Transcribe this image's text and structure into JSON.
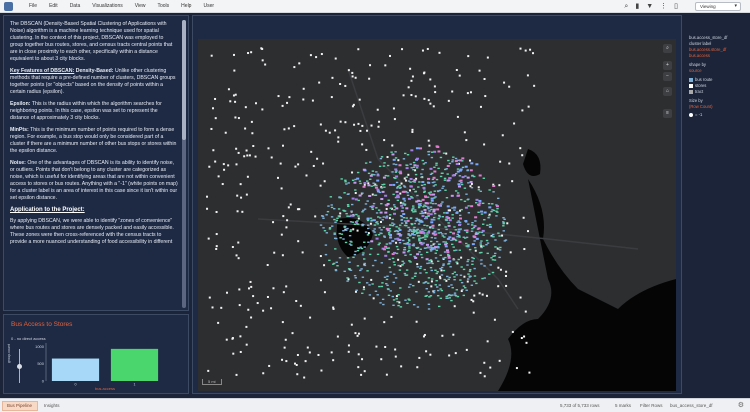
{
  "menu": [
    "File",
    "Edit",
    "Data",
    "Visualizations",
    "View",
    "Tools",
    "Help",
    "User"
  ],
  "toolbar": {
    "icons": [
      "search-icon",
      "bookmark-icon",
      "filter-icon",
      "more-icon",
      "file-icon"
    ],
    "viewing_label": "Viewing"
  },
  "text_panel": {
    "p1": "The DBSCAN (Density-Based Spatial Clustering of Applications with Noise) algorithm is a machine learning technique used for spatial clustering. In the context of this project, DBSCAN was employed to group together bus routes, stores, and census tracts central points that are in close proximity to each other, specifically within a distance equivalent to about 3 city blocks.",
    "kf_head": "Key Features of DBSCAN:",
    "kf_lead": "Density-Based:",
    "kf_body": "Unlike other clustering methods that require a pre-defined number of clusters, DBSCAN groups together points (or \"objects\" based on the density of points within a certain radius (epsilon).",
    "eps_lead": "Epsilon:",
    "eps_body": "This is the radius within which the algorithm searches for neighboring points. In this case, epsilon was set to represent the distance of approximately 3 city blocks.",
    "minpts_lead": "MinPts:",
    "minpts_body": "This is the minimum number of points required to form a dense region. For example, a bus stop would only be considered part of a cluster if there are a minimum number of other bus stops or stores within the epsilon distance.",
    "noise_lead": "Noise:",
    "noise_body": "One of the advantages of DBSCAN is its ability to identify noise, or outliers. Points that don't belong to any cluster are categorized as noise, which is useful for identifying areas that are not within convenient access to stores or bus routes. Anything with a \"-1\" (white points on map) for a cluster label is an area of interest in this case since it isn't within our set epsilon distance.",
    "app_head": "Application to the Project:",
    "app_body": "By applying DBSCAN, we were able to identify \"zones of convenience\" where bus routes and stores are densely packed and easily accessible. These zones were then cross-referenced with the census tracts to provide a more nuanced understanding of food accessibility in different"
  },
  "bus_chart": {
    "title": "Bus Access to Stores",
    "subtitle": "0 - no direct access",
    "slider_label": "group.count",
    "slider_value": 0.5,
    "xlabel": "bus.access"
  },
  "chart_data": {
    "type": "bar",
    "categories": [
      "0",
      "1"
    ],
    "values": [
      650,
      930
    ],
    "xlabel": "bus.access",
    "yticks": [
      "1000",
      "500",
      "0"
    ],
    "ylim": [
      0,
      1100
    ],
    "colors": [
      "#a8d8f8",
      "#4bd66d"
    ]
  },
  "map": {
    "scale_label": "5 mi",
    "buttons": [
      "search-icon",
      "zoom-in-icon",
      "zoom-out-icon",
      "compass-icon",
      "layers-icon"
    ]
  },
  "legend": {
    "color_title": "bus.access_store_df",
    "color_sub": "cluster label",
    "color_link": "bus.access.store_df bus.access",
    "shape_title": "shape by",
    "shape_val": "source",
    "items": [
      {
        "label": "bus route",
        "color": "#7fb0d8"
      },
      {
        "label": "stores",
        "color": "#ffffff"
      },
      {
        "label": "tract",
        "color": "#aaaaaa"
      }
    ],
    "size_title": "Size by",
    "size_val": "(Row Count)",
    "noise_label": "= -1"
  },
  "statusbar": {
    "active_tab": "Bus Pipeline",
    "tab2": "Insights",
    "rows": "5,733 of 5,733 rows",
    "marks": "5 marks",
    "filters": "Filter Rows",
    "source": "bus_access_store_df"
  },
  "colors": {
    "accent": "#e8623a",
    "panel": "#1e2a44",
    "bus": "#4fd8a6",
    "cluster": "#9a7fe0"
  }
}
